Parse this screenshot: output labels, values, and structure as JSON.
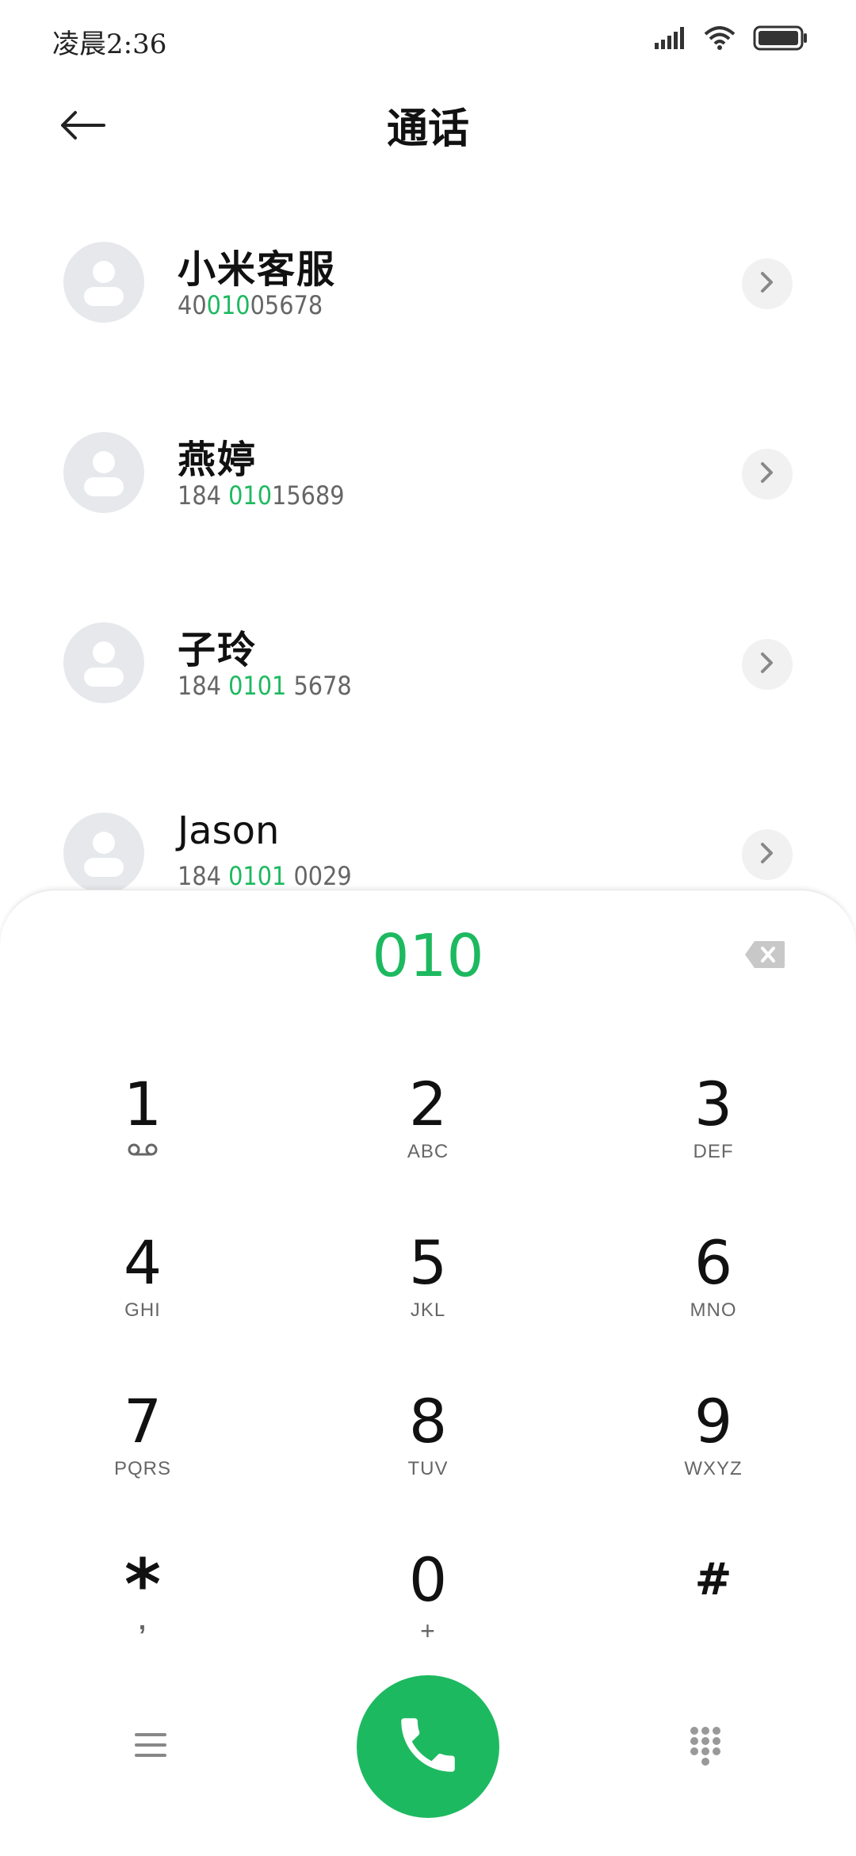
{
  "status_bar": {
    "time": "凌晨2:36"
  },
  "header": {
    "title": "通话"
  },
  "contacts": [
    {
      "name": "小米客服",
      "number_parts": [
        "40",
        "010",
        "05678"
      ]
    },
    {
      "name": "燕婷",
      "number_parts": [
        "184 ",
        "010",
        "15689"
      ]
    },
    {
      "name": "子玲",
      "number_parts": [
        "184 ",
        "0101",
        " 5678"
      ]
    },
    {
      "name": "Jason",
      "number_parts": [
        "184 ",
        "0101",
        " 0029"
      ]
    }
  ],
  "dialer": {
    "input": "010",
    "keys": [
      {
        "digit": "1",
        "letters": ""
      },
      {
        "digit": "2",
        "letters": "ABC"
      },
      {
        "digit": "3",
        "letters": "DEF"
      },
      {
        "digit": "4",
        "letters": "GHI"
      },
      {
        "digit": "5",
        "letters": "JKL"
      },
      {
        "digit": "6",
        "letters": "MNO"
      },
      {
        "digit": "7",
        "letters": "PQRS"
      },
      {
        "digit": "8",
        "letters": "TUV"
      },
      {
        "digit": "9",
        "letters": "WXYZ"
      },
      {
        "digit": "*",
        "letters": ","
      },
      {
        "digit": "0",
        "letters": "+"
      },
      {
        "digit": "#",
        "letters": ""
      }
    ]
  },
  "icons": {
    "back": "arrow-left-icon",
    "chevron": "chevron-right-icon",
    "backspace": "backspace-icon",
    "voicemail": "voicemail-icon",
    "menu": "menu-icon",
    "call": "phone-icon",
    "keypad": "keypad-icon"
  },
  "colors": {
    "accent": "#1db960",
    "avatar_bg": "#e6e8ec"
  }
}
